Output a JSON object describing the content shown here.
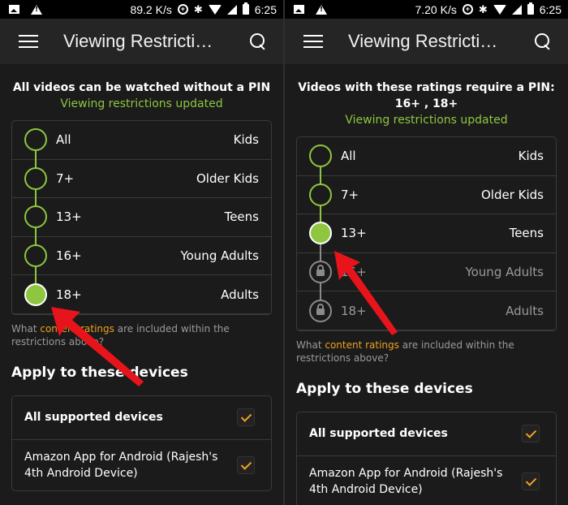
{
  "accent_color": "#8ec63f",
  "link_color": "#f0a01f",
  "screens": [
    {
      "statusbar": {
        "speed": "89.2 K/s",
        "time": "6:25"
      },
      "toolbar": {
        "title": "Viewing Restricti…"
      },
      "summary": "All videos can be watched without a PIN",
      "status": "Viewing restrictions updated",
      "ratings": [
        {
          "code": "All",
          "label": "Kids",
          "state": "open"
        },
        {
          "code": "7+",
          "label": "Older Kids",
          "state": "open"
        },
        {
          "code": "13+",
          "label": "Teens",
          "state": "open"
        },
        {
          "code": "16+",
          "label": "Young Adults",
          "state": "open"
        },
        {
          "code": "18+",
          "label": "Adults",
          "state": "selected"
        }
      ],
      "help": {
        "prefix": "What ",
        "link": "content ratings",
        "suffix": " are included within the restrictions above?"
      },
      "devices_title": "Apply to these devices",
      "devices": [
        {
          "label": "All supported devices",
          "checked": true
        },
        {
          "label": "Amazon App for Android (Rajesh's 4th Android Device)",
          "checked": true
        }
      ]
    },
    {
      "statusbar": {
        "speed": "7.20 K/s",
        "time": "6:25"
      },
      "toolbar": {
        "title": "Viewing Restricti…"
      },
      "summary": "Videos with these ratings require a PIN: 16+ , 18+",
      "status": "Viewing restrictions updated",
      "ratings": [
        {
          "code": "All",
          "label": "Kids",
          "state": "open"
        },
        {
          "code": "7+",
          "label": "Older Kids",
          "state": "open"
        },
        {
          "code": "13+",
          "label": "Teens",
          "state": "selected"
        },
        {
          "code": "16+",
          "label": "Young Adults",
          "state": "locked"
        },
        {
          "code": "18+",
          "label": "Adults",
          "state": "locked"
        }
      ],
      "help": {
        "prefix": "What ",
        "link": "content ratings",
        "suffix": " are included within the restrictions above?"
      },
      "devices_title": "Apply to these devices",
      "devices": [
        {
          "label": "All supported devices",
          "checked": true
        },
        {
          "label": "Amazon App for Android (Rajesh's 4th Android Device)",
          "checked": true
        }
      ]
    }
  ]
}
